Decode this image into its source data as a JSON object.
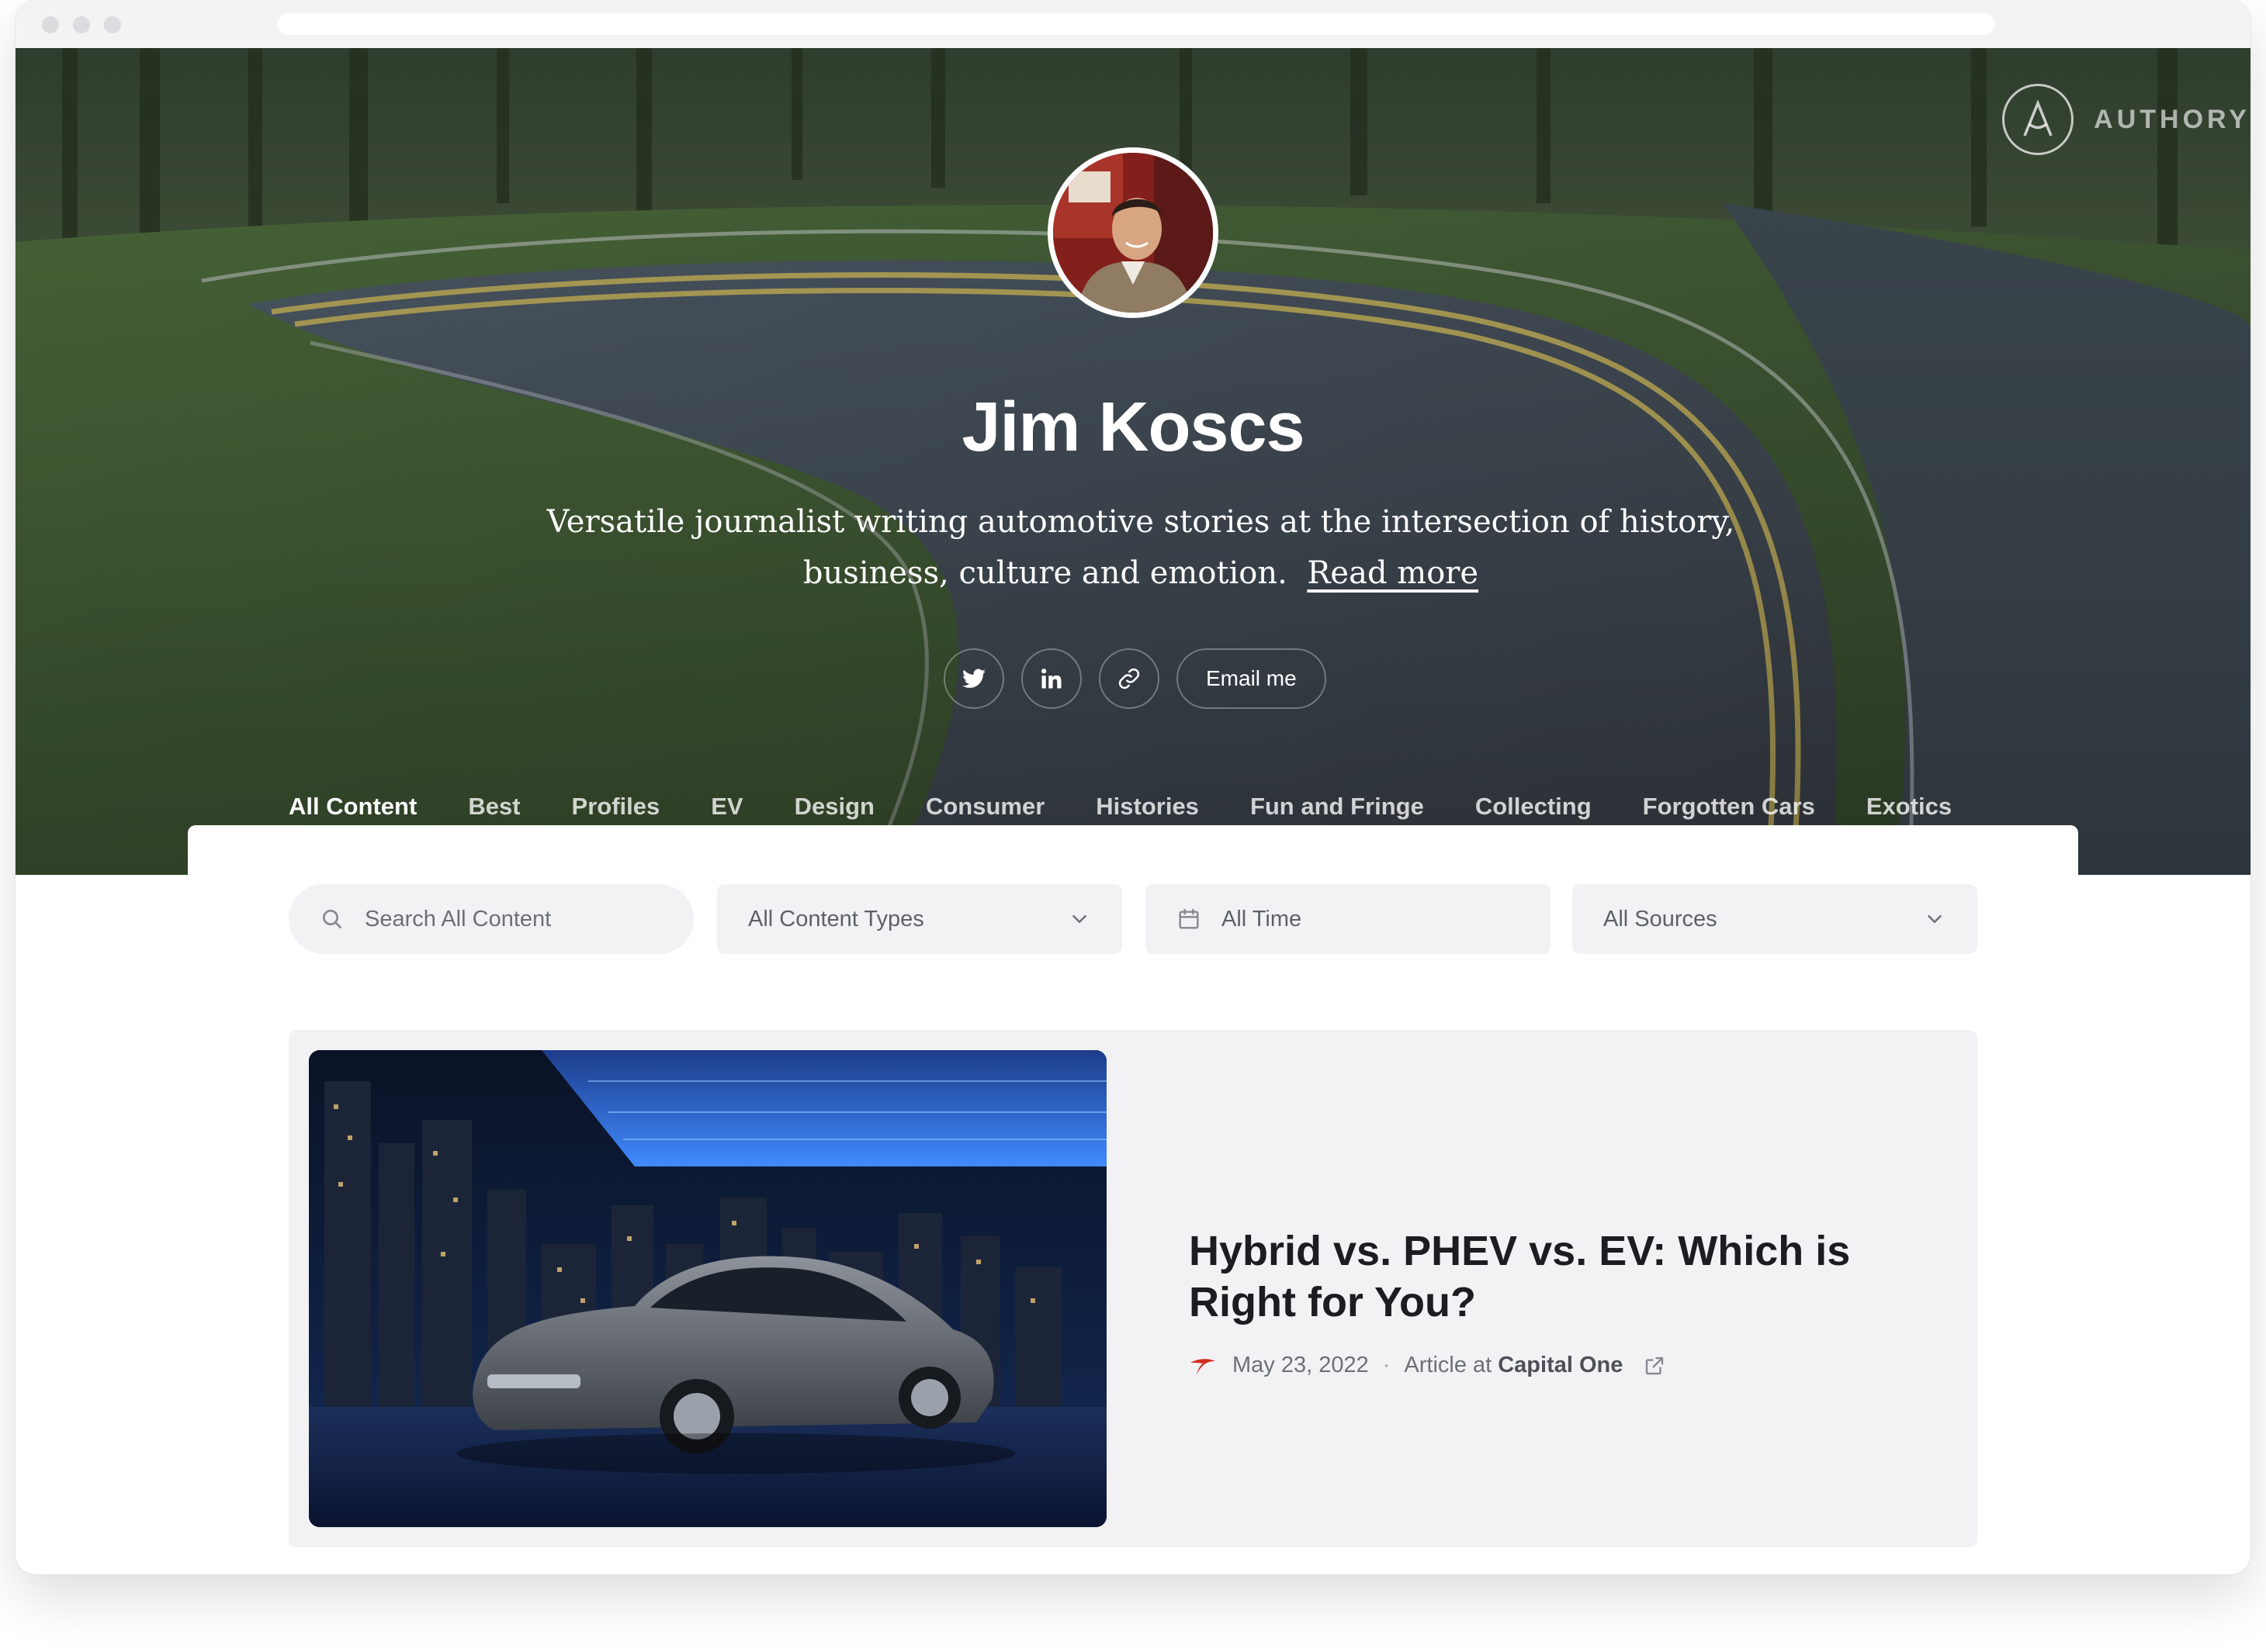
{
  "brand": {
    "name": "AUTHORY"
  },
  "profile": {
    "name": "Jim Koscs",
    "bio": "Versatile journalist writing automotive stories at the intersection of history, business, culture and emotion.",
    "read_more": "Read more"
  },
  "social": {
    "icons": [
      "twitter-icon",
      "linkedin-icon",
      "link-icon"
    ],
    "email_label": "Email me"
  },
  "tabs": {
    "active": "All Content",
    "items": [
      "All Content",
      "Best",
      "Profiles",
      "EV",
      "Design",
      "Consumer",
      "Histories",
      "Fun and Fringe",
      "Collecting",
      "Forgotten Cars",
      "Exotics"
    ]
  },
  "filters": {
    "search_placeholder": "Search All Content",
    "content_types": "All Content Types",
    "time": "All Time",
    "sources": "All Sources"
  },
  "article": {
    "title": "Hybrid vs. PHEV vs. EV: Which is Right for You?",
    "date": "May 23, 2022",
    "separator": "·",
    "type_prefix": "Article at",
    "source": "Capital One"
  },
  "colors": {
    "accent": "#3b72e6",
    "source_logo": "#d22e1e",
    "title": "#1d1d21"
  }
}
